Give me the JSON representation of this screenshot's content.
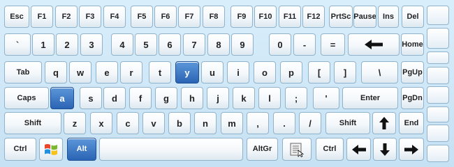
{
  "keyboard": {
    "row_fn": {
      "esc": "Esc",
      "f1": "F1",
      "f2": "F2",
      "f3": "F3",
      "f4": "F4",
      "f5": "F5",
      "f6": "F6",
      "f7": "F7",
      "f8": "F8",
      "f9": "F9",
      "f10": "F10",
      "f11": "F11",
      "f12": "F12",
      "prtsc": "PrtSc",
      "pause": "Pause",
      "ins": "Ins",
      "del": "Del"
    },
    "row_num": {
      "backtick": "`",
      "k1": "1",
      "k2": "2",
      "k3": "3",
      "k4": "4",
      "k5": "5",
      "k6": "6",
      "k7": "7",
      "k8": "8",
      "k9": "9",
      "k0": "0",
      "minus": "-",
      "equals": "=",
      "home": "Home"
    },
    "row_q": {
      "tab": "Tab",
      "q": "q",
      "w": "w",
      "e": "e",
      "r": "r",
      "t": "t",
      "y": "y",
      "u": "u",
      "i": "i",
      "o": "o",
      "p": "p",
      "lbracket": "[",
      "rbracket": "]",
      "backslash": "\\",
      "pgup": "PgUp"
    },
    "row_a": {
      "caps": "Caps",
      "a": "a",
      "s": "s",
      "d": "d",
      "f": "f",
      "g": "g",
      "h": "h",
      "j": "j",
      "k": "k",
      "l": "l",
      "semicolon": ";",
      "quote": "'",
      "enter": "Enter",
      "pgdn": "PgDn"
    },
    "row_z": {
      "shift_left": "Shift",
      "z": "z",
      "x": "x",
      "c": "c",
      "v": "v",
      "b": "b",
      "n": "n",
      "m": "m",
      "comma": ",",
      "period": ".",
      "slash": "/",
      "shift_right": "Shift",
      "end": "End"
    },
    "row_bottom": {
      "ctrl_left": "Ctrl",
      "alt": "Alt",
      "altgr": "AltGr",
      "ctrl_right": "Ctrl"
    },
    "highlighted_keys": [
      "y",
      "a",
      "Alt"
    ],
    "colors": {
      "background": "#cfe6f5",
      "key_face": "#f4f8fb",
      "key_border": "#8fb3cc",
      "highlight": "#2a64b4"
    },
    "icons": {
      "backspace": "arrow-left-icon",
      "up": "arrow-up-icon",
      "down": "arrow-down-icon",
      "left": "arrow-left-icon",
      "right": "arrow-right-icon",
      "windows": "windows-logo-icon",
      "menu": "context-menu-icon"
    }
  }
}
